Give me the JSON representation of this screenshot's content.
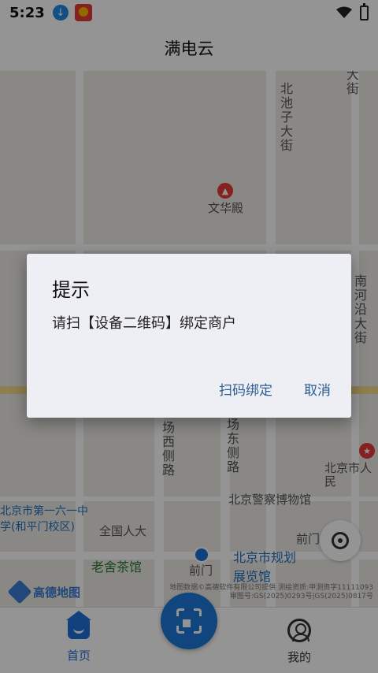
{
  "status_bar": {
    "time": "5:23"
  },
  "app": {
    "title": "满电云"
  },
  "map": {
    "labels": {
      "beichizi": "北池子大街",
      "wenhuadian": "文华殿",
      "nanheyan": "南河沿大街",
      "changxi": "场西侧路",
      "changdong": "场东侧路",
      "police_museum": "北京警察博物馆",
      "renmin": "北京市人民",
      "yizhong": "北京市第一六一中学(和平门校区)",
      "renda": "全国人大",
      "laoshe": "老舍茶馆",
      "qianmen": "前门",
      "planning": "北京市规划展览馆",
      "qianmen_east": "前门东大街",
      "da": "大街",
      "bei": "北京",
      "qiang": "前门"
    },
    "brand": "高德地图",
    "copyright_line1": "地图数据©高德软件有限公司提供  测绘资质:甲测资字11111093",
    "copyright_line2": "审图号:GS(2025)0293号|GS(2025)0817号"
  },
  "dialog": {
    "title": "提示",
    "message": "请扫【设备二维码】绑定商户",
    "confirm_label": "扫码绑定",
    "cancel_label": "取消"
  },
  "tabbar": {
    "home_label": "首页",
    "me_label": "我的"
  },
  "colors": {
    "accent": "#1e78d8",
    "dialog_button": "#2b5d92"
  }
}
